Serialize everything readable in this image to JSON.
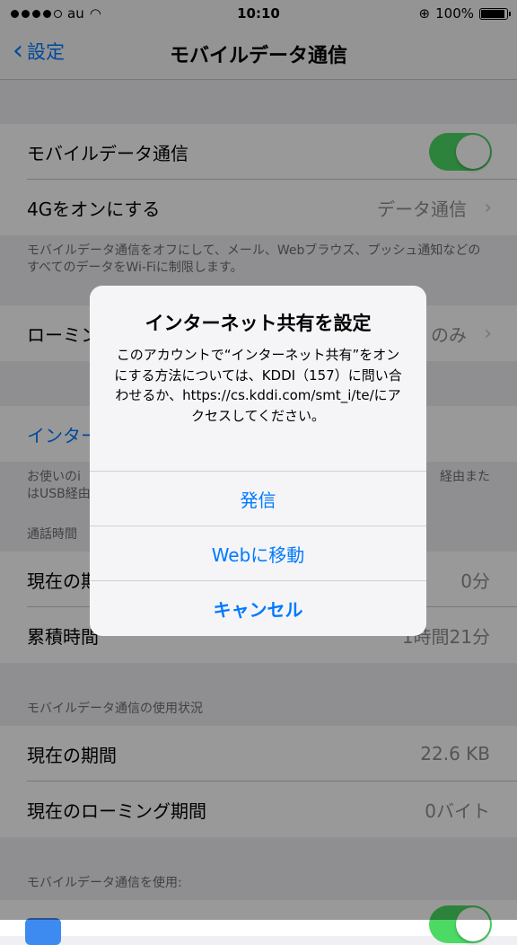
{
  "status": {
    "carrier": "au",
    "time": "10:10",
    "battery": "100%"
  },
  "nav": {
    "back": "設定",
    "title": "モバイルデータ通信"
  },
  "cells": {
    "mobile_data": "モバイルデータ通信",
    "lte": "4Gをオンにする",
    "lte_value": "データ通信",
    "footer1": "モバイルデータ通信をオフにして、メール、Webブラウズ、プッシュ通知などのすべてのデータをWi-Fiに制限します。",
    "roaming": "ローミン",
    "roaming_value": "のみ",
    "hotspot": "インター",
    "footer2": "お使いのi",
    "footer2b": "はUSB経由",
    "footer2r": "経由また",
    "call_time_header": "通話時間",
    "current_period": "現在の期",
    "current_period_value": "0分",
    "lifetime": "累積時間",
    "lifetime_value": "1時間21分",
    "usage_header": "モバイルデータ通信の使用状況",
    "usage_current": "現在の期間",
    "usage_current_value": "22.6 KB",
    "usage_roaming": "現在のローミング期間",
    "usage_roaming_value": "0バイト",
    "use_for_header": "モバイルデータ通信を使用:"
  },
  "alert": {
    "title": "インターネット共有を設定",
    "message": "このアカウントで“インターネット共有”をオンにする方法については、KDDI（157）に問い合わせるか、https://cs.kddi.com/smt_i/te/にアクセスしてください。",
    "btn_call": "発信",
    "btn_web": "Webに移動",
    "btn_cancel": "キャンセル"
  },
  "colors": {
    "accent": "#007aff",
    "toggle_on": "#4cd964"
  }
}
